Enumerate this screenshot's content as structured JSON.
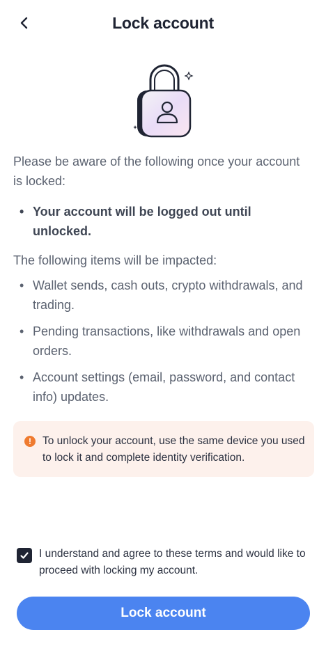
{
  "header": {
    "title": "Lock account",
    "back_icon": "chevron-left-icon"
  },
  "illustration": {
    "icon": "padlock-user-icon",
    "accent": "#e8d8ff"
  },
  "intro": "Please be aware of the following once your account is locked:",
  "key_point": "Your account will be logged out until unlocked.",
  "impact_heading": "The following items will be impacted:",
  "impacted_items": [
    "Wallet sends, cash outs, crypto withdrawals, and trading.",
    "Pending transactions, like withdrawals and open orders.",
    "Account settings (email, password, and contact info) updates."
  ],
  "warning": {
    "icon": "exclamation-circle-icon",
    "text": "To unlock your account, use the same device you used to lock it and complete identity verification.",
    "background": "#fdf1ec",
    "icon_color": "#ef7b30"
  },
  "agreement": {
    "checked": true,
    "text": "I understand and agree to these terms and would like to proceed with locking my account."
  },
  "primary_button": {
    "label": "Lock account",
    "color": "#4b84f0"
  }
}
